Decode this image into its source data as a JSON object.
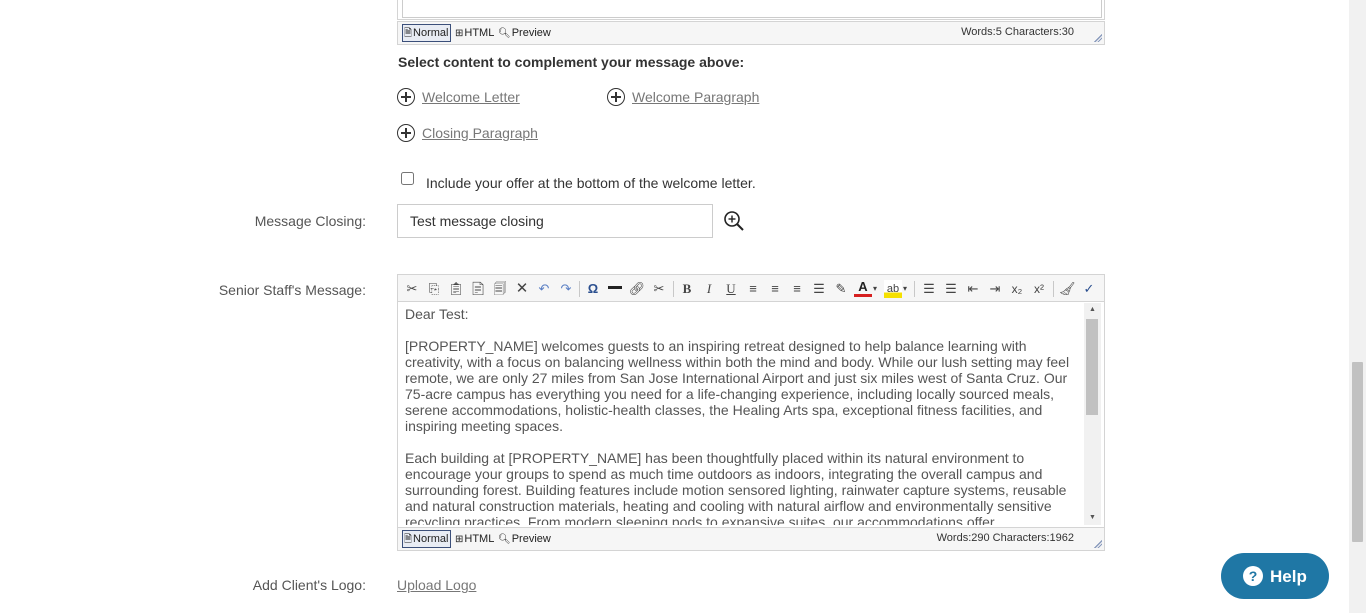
{
  "top_editor": {
    "modes": {
      "normal": "Normal",
      "html": "HTML",
      "preview": "Preview"
    },
    "counter": "Words:5 Characters:30"
  },
  "complement": {
    "heading": "Select content to complement your message above:",
    "links": {
      "welcome_letter": "Welcome Letter",
      "welcome_paragraph": "Welcome Paragraph",
      "closing_paragraph": "Closing Paragraph"
    },
    "include_offer_label": "Include your offer at the bottom of the welcome letter.",
    "include_offer_checked": false
  },
  "message_closing": {
    "label": "Message Closing:",
    "value": "Test message closing"
  },
  "senior_staff": {
    "label": "Senior Staff's Message:",
    "greeting": "Dear Test:",
    "paragraph_1": "[PROPERTY_NAME] welcomes guests to an inspiring retreat designed to help balance learning with creativity, with a focus on balancing wellness within both the mind and body. While our lush setting may feel remote, we are only 27 miles from San Jose International Airport and just six miles west of Santa Cruz. Our 75-acre campus has everything you need for a life-changing experience, including locally sourced meals, serene accommodations, holistic-health classes, the Healing Arts spa, exceptional fitness facilities, and inspiring meeting spaces.",
    "paragraph_2": "Each building at [PROPERTY_NAME] has been thoughtfully placed within its natural environment to encourage your groups to spend as much time outdoors as indoors, integrating the overall campus and surrounding forest. Building features include motion sensored lighting, rainwater capture systems, reusable and natural construction materials, heating and cooling with natural airflow and environmentally sensitive recycling practices. From modern sleeping pods to expansive suites, our accommodations offer",
    "modes": {
      "normal": "Normal",
      "html": "HTML",
      "preview": "Preview"
    },
    "counter": "Words:290 Characters:1962"
  },
  "client_logo": {
    "label": "Add Client's Logo:",
    "upload": "Upload Logo"
  },
  "help_button": {
    "label": "Help"
  },
  "colors": {
    "help": "#1f77a5",
    "link": "#777777"
  }
}
